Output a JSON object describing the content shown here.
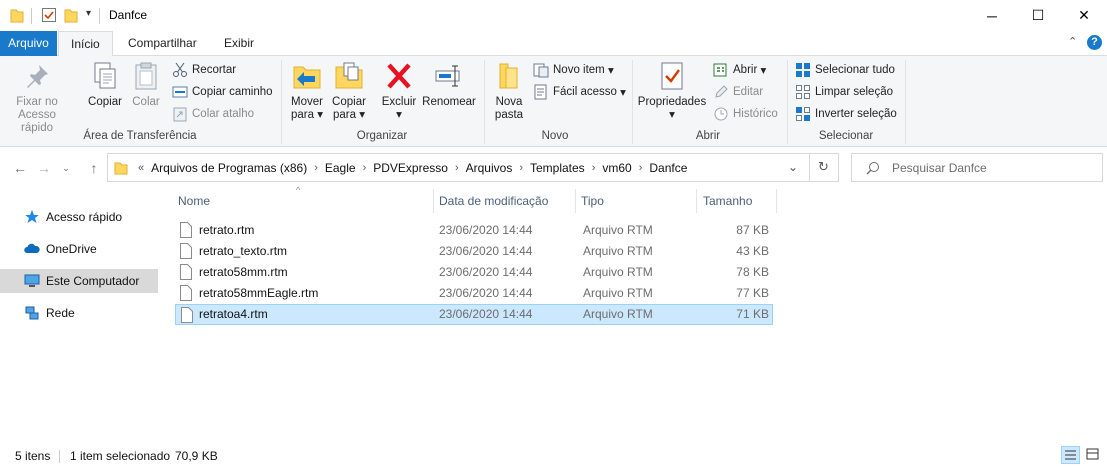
{
  "window": {
    "title": "Danfce"
  },
  "window_controls": {
    "minimize": "─",
    "maximize": "☐",
    "close": "✕"
  },
  "tabs": {
    "file": "Arquivo",
    "home": "Início",
    "share": "Compartilhar",
    "view": "Exibir"
  },
  "ribbon": {
    "clipboard": {
      "label": "Área de Transferência",
      "pin_line1": "Fixar no",
      "pin_line2": "Acesso rápido",
      "copy": "Copiar",
      "paste": "Colar",
      "cut": "Recortar",
      "copy_path": "Copiar caminho",
      "paste_shortcut": "Colar atalho"
    },
    "organize": {
      "label": "Organizar",
      "move_line1": "Mover",
      "move_line2": "para",
      "copy_line1": "Copiar",
      "copy_line2": "para",
      "delete": "Excluir",
      "rename": "Renomear"
    },
    "new": {
      "label": "Novo",
      "folder_line1": "Nova",
      "folder_line2": "pasta",
      "new_item": "Novo item",
      "easy_access": "Fácil acesso"
    },
    "open": {
      "label": "Abrir",
      "properties": "Propriedades",
      "open": "Abrir",
      "edit": "Editar",
      "history": "Histórico"
    },
    "select": {
      "label": "Selecionar",
      "select_all": "Selecionar tudo",
      "select_none": "Limpar seleção",
      "invert": "Inverter seleção"
    }
  },
  "address": {
    "overflow": "«",
    "crumbs": [
      "Arquivos de Programas (x86)",
      "Eagle",
      "PDVExpresso",
      "Arquivos",
      "Templates",
      "vm60",
      "Danfce"
    ]
  },
  "search": {
    "placeholder": "Pesquisar Danfce"
  },
  "sidebar": {
    "items": [
      {
        "label": "Acesso rápido",
        "icon": "star-icon"
      },
      {
        "label": "OneDrive",
        "icon": "cloud-icon"
      },
      {
        "label": "Este Computador",
        "icon": "computer-icon",
        "selected": true
      },
      {
        "label": "Rede",
        "icon": "network-icon"
      }
    ]
  },
  "columns": {
    "name": "Nome",
    "date": "Data de modificação",
    "type": "Tipo",
    "size": "Tamanho"
  },
  "files": [
    {
      "name": "retrato.rtm",
      "date": "23/06/2020 14:44",
      "type": "Arquivo RTM",
      "size": "87 KB"
    },
    {
      "name": "retrato_texto.rtm",
      "date": "23/06/2020 14:44",
      "type": "Arquivo RTM",
      "size": "43 KB"
    },
    {
      "name": "retrato58mm.rtm",
      "date": "23/06/2020 14:44",
      "type": "Arquivo RTM",
      "size": "78 KB"
    },
    {
      "name": "retrato58mmEagle.rtm",
      "date": "23/06/2020 14:44",
      "type": "Arquivo RTM",
      "size": "77 KB"
    },
    {
      "name": "retratoa4.rtm",
      "date": "23/06/2020 14:44",
      "type": "Arquivo RTM",
      "size": "71 KB",
      "selected": true
    }
  ],
  "status": {
    "count": "5 itens",
    "selection": "1 item selecionado",
    "size": "70,9 KB"
  },
  "colors": {
    "accent": "#1979ca",
    "selection": "#cce8ff",
    "selection_border": "#99d1ff",
    "delete_red": "#e81123",
    "folder": "#ffd75e"
  }
}
